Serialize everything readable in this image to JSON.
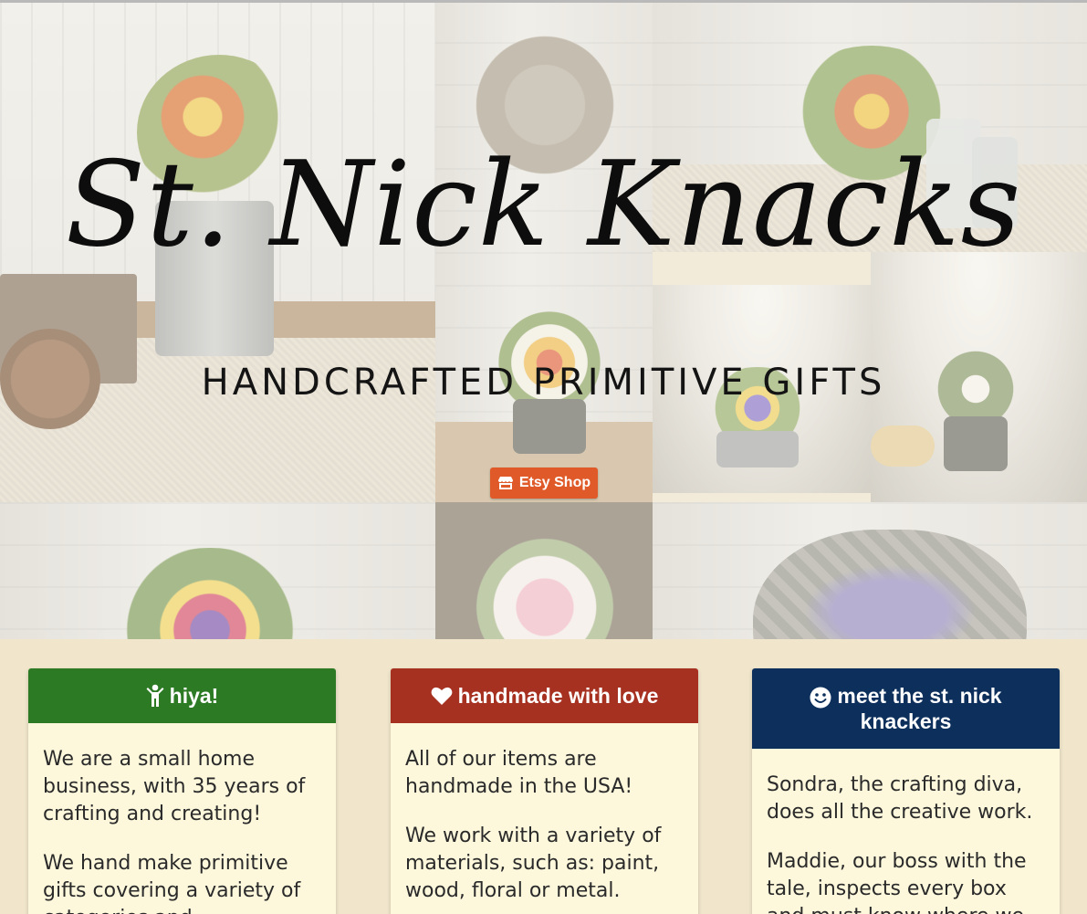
{
  "hero": {
    "site_title": "St. Nick Knacks",
    "tagline": "HANDCRAFTED PRIMITIVE GIFTS",
    "etsy_button_label": "Etsy Shop",
    "etsy_icon": "store-icon"
  },
  "colors": {
    "background": "#f1e6cc",
    "etsy_orange": "#e05a29",
    "card_green": "#2d7a25",
    "card_red": "#a73121",
    "card_navy": "#0d2f5c",
    "card_body": "#fdf8dc"
  },
  "cards": [
    {
      "icon": "child-icon",
      "title": "hiya!",
      "paragraphs": [
        "We are a small home business, with 35 years of crafting and creating!",
        "We hand make primitive gifts covering a variety of categories and"
      ]
    },
    {
      "icon": "heart-icon",
      "title": "handmade with love",
      "paragraphs": [
        "All of our items are handmade in the USA!",
        "We work with a variety of materials, such as: paint, wood, floral or metal."
      ]
    },
    {
      "icon": "smile-icon",
      "title": "meet the st. nick knackers",
      "paragraphs": [
        "Sondra, the crafting diva, does all the creative work.",
        "Maddie, our boss with the tale, inspects every box and must know where we"
      ]
    }
  ]
}
